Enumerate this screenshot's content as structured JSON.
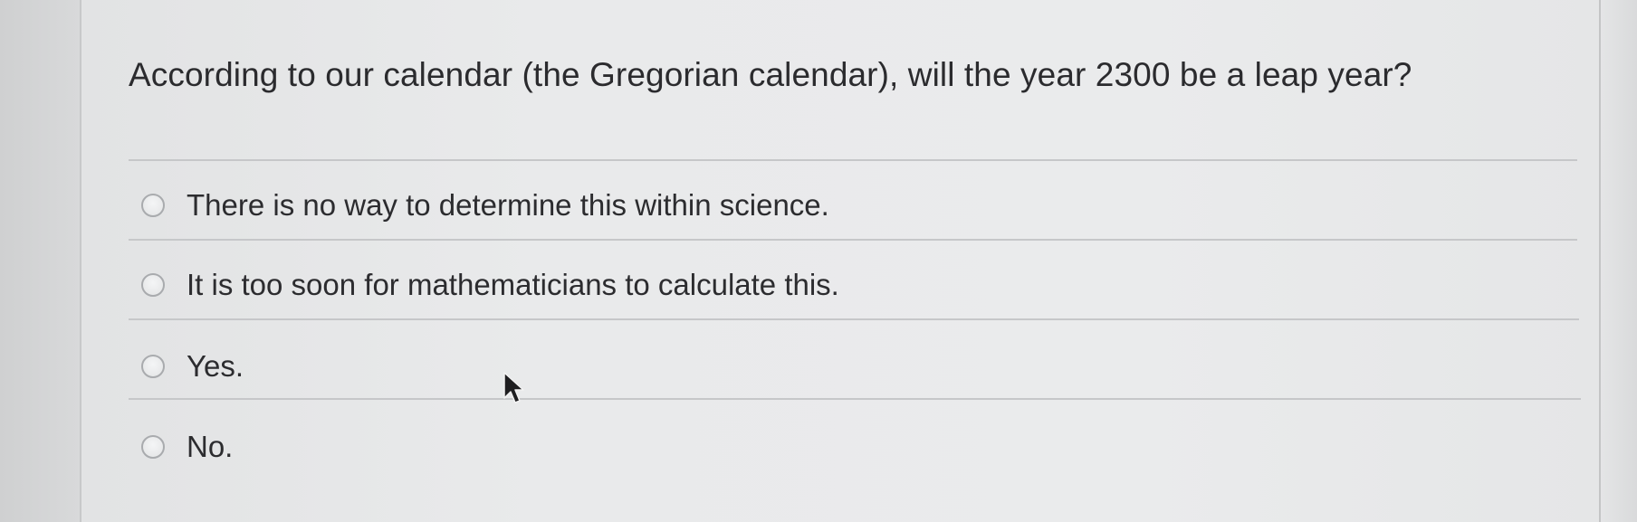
{
  "question": {
    "text": "According to our calendar (the Gregorian calendar), will the year 2300 be a leap year?"
  },
  "options": [
    {
      "label": "There is no way to determine this within science.",
      "selected": false
    },
    {
      "label": "It is too soon for mathematicians to calculate this.",
      "selected": false
    },
    {
      "label": "Yes.",
      "selected": false
    },
    {
      "label": "No.",
      "selected": false
    }
  ],
  "cursor": {
    "icon": "mouse-pointer-icon"
  }
}
